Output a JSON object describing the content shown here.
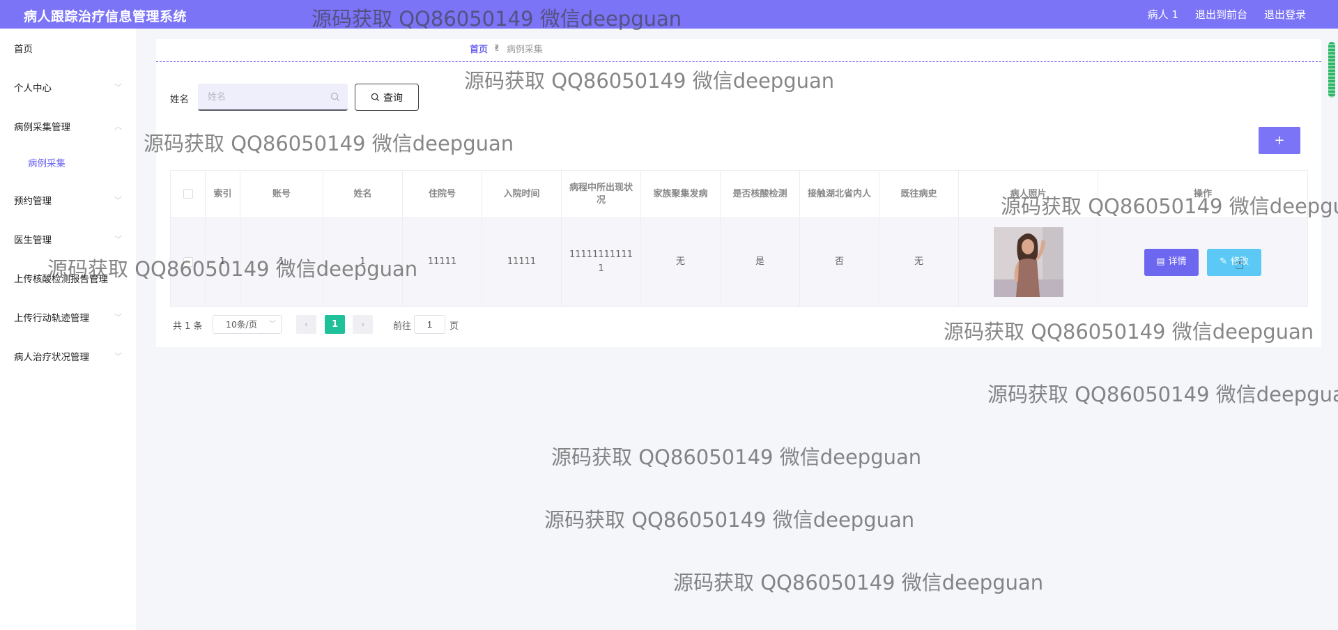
{
  "header": {
    "app_title": "病人跟踪治疗信息管理系统",
    "nav": [
      "病人 1",
      "退出到前台",
      "退出登录"
    ]
  },
  "sidebar": {
    "items": [
      {
        "label": "首页"
      },
      {
        "label": "个人中心"
      },
      {
        "label": "病例采集管理"
      },
      {
        "label": "病例采集"
      },
      {
        "label": "预约管理"
      },
      {
        "label": "医生管理"
      },
      {
        "label": "上传核酸检测报告管理"
      },
      {
        "label": "上传行动轨迹管理"
      },
      {
        "label": "病人治疗状况管理"
      }
    ]
  },
  "breadcrumb": {
    "home": "首页",
    "current": "病例采集"
  },
  "search": {
    "label": "姓名",
    "placeholder": "姓名",
    "button": "查询"
  },
  "add_button": "+",
  "table": {
    "headers": [
      "索引",
      "账号",
      "姓名",
      "住院号",
      "入院时间",
      "病程中所出现状况",
      "家族聚集发病",
      "是否核酸检测",
      "接触湖北省内人",
      "既往病史",
      "病人照片",
      "操作"
    ],
    "rows": [
      {
        "index": "1",
        "account": "1",
        "name": "1",
        "inpatient_no": "11111",
        "admission_time": "11111",
        "condition": "111111111111",
        "family_cluster": "无",
        "nucleic_test": "是",
        "hubei_contact": "否",
        "history": "无"
      }
    ],
    "actions": {
      "detail": "详情",
      "edit": "修改"
    }
  },
  "pagination": {
    "total": "共 1 条",
    "page_size": "10条/页",
    "current_page": "1",
    "goto_label": "前往",
    "goto_value": "1",
    "page_suffix": "页"
  },
  "watermark": "源码获取 QQ86050149 微信deepguan",
  "colors": {
    "primary": "#7b74f6",
    "active_page": "#1fc19a",
    "edit_button": "#5bc8f5"
  }
}
